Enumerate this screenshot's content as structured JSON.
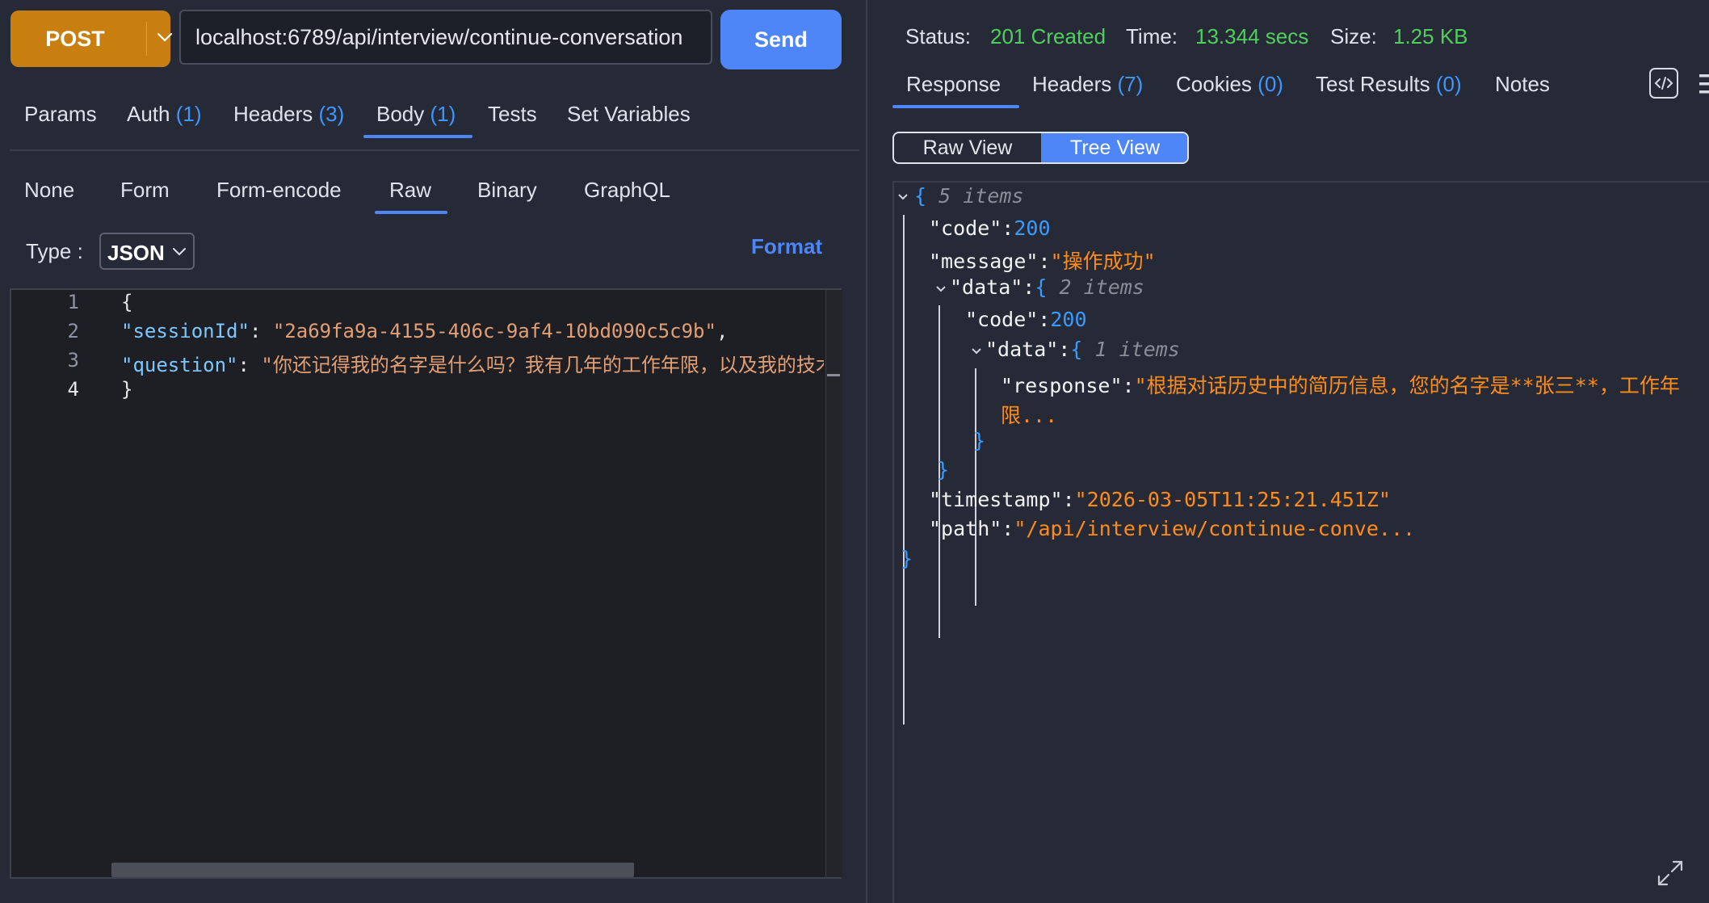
{
  "request": {
    "method": "POST",
    "url": "localhost:6789/api/interview/continue-conversation",
    "send_label": "Send"
  },
  "request_tabs": [
    {
      "label": "Params",
      "count": ""
    },
    {
      "label": "Auth",
      "count": "(1)"
    },
    {
      "label": "Headers",
      "count": "(3)"
    },
    {
      "label": "Body",
      "count": "(1)",
      "active": true
    },
    {
      "label": "Tests",
      "count": ""
    },
    {
      "label": "Set Variables",
      "count": ""
    }
  ],
  "body_tabs": [
    "None",
    "Form",
    "Form-encode",
    "Raw",
    "Binary",
    "GraphQL"
  ],
  "body_active_tab": "Raw",
  "type_label": "Type :",
  "type_value": "JSON",
  "format_label": "Format",
  "editor": {
    "line_numbers": [
      "1",
      "2",
      "3",
      "4"
    ],
    "open_brace": "{",
    "close_brace": "}",
    "l2_key": "\"sessionId\"",
    "l2_colon": ": ",
    "l2_value": "\"2a69fa9a-4155-406c-9af4-10bd090c5c9b\"",
    "l2_comma": ",",
    "l3_key": "\"question\"",
    "l3_colon": ": ",
    "l3_value": "\"你还记得我的名字是什么吗？我有几年的工作年限，以及我的技术栈"
  },
  "status": {
    "status_label": "Status:",
    "status_value": "201 Created",
    "time_label": "Time:",
    "time_value": "13.344 secs",
    "size_label": "Size:",
    "size_value": "1.25 KB"
  },
  "response_tabs": [
    {
      "label": "Response",
      "count": "",
      "active": true
    },
    {
      "label": "Headers",
      "count": "(7)"
    },
    {
      "label": "Cookies",
      "count": "(0)"
    },
    {
      "label": "Test Results",
      "count": "(0)"
    },
    {
      "label": "Notes",
      "count": ""
    }
  ],
  "view_toggle": {
    "raw": "Raw View",
    "tree": "Tree View",
    "active": "Tree View"
  },
  "tree": {
    "root_count": "5 items",
    "code_key": "\"code\":",
    "code_value": "200",
    "message_key": "\"message\":",
    "message_value": "\"操作成功\"",
    "data_key": "\"data\":",
    "data_count": "2 items",
    "inner_code_key": "\"code\":",
    "inner_code_value": "200",
    "inner_data_key": "\"data\":",
    "inner_data_count": "1 items",
    "response_key": "\"response\":",
    "response_value_1": "\"根据对话历史中的简历信息，您的名字是**张三**，工作年",
    "response_value_2": "限...",
    "timestamp_key": "\"timestamp\":",
    "timestamp_value": "\"2026-03-05T11:25:21.451Z\"",
    "path_key": "\"path\":",
    "path_value": "\"/api/interview/continue-conve...",
    "open_brace": "{",
    "close_brace": "}"
  },
  "colors": {
    "method_bg": "#c87f0f",
    "send_bg": "#4e86f7",
    "status_ok": "#4fcf5b",
    "count_blue": "#3d97ff",
    "string_orange": "#ff8c1a"
  },
  "icons": [
    "chevron-down-icon",
    "code-icon",
    "menu-icon",
    "expand-icon",
    "chevron-down-icon"
  ]
}
